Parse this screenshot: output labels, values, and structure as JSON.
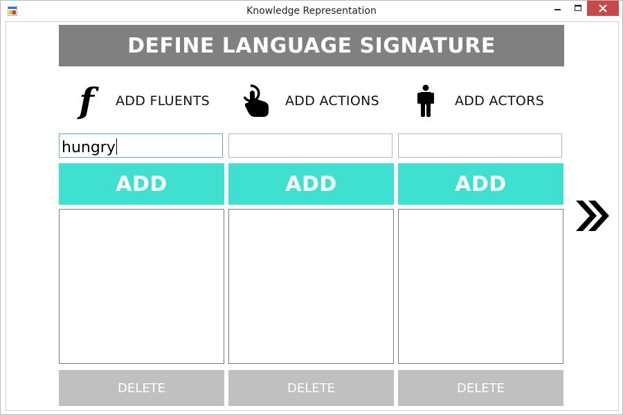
{
  "window": {
    "title": "Knowledge Representation"
  },
  "header": {
    "title": "DEFINE LANGUAGE SIGNATURE"
  },
  "columns": [
    {
      "label": "ADD FLUENTS",
      "icon": "function-f-icon",
      "input_value": "hungry",
      "add_label": "ADD",
      "delete_label": "DELETE"
    },
    {
      "label": "ADD ACTIONS",
      "icon": "touch-hand-icon",
      "input_value": "",
      "add_label": "ADD",
      "delete_label": "DELETE"
    },
    {
      "label": "ADD ACTORS",
      "icon": "person-icon",
      "input_value": "",
      "add_label": "ADD",
      "delete_label": "DELETE"
    }
  ],
  "navigation": {
    "next_icon": "double-chevron-right-icon"
  },
  "colors": {
    "banner": "#808080",
    "add_button": "#40e0d0",
    "delete_button": "#c0c0c0",
    "close_button": "#c7484b"
  }
}
